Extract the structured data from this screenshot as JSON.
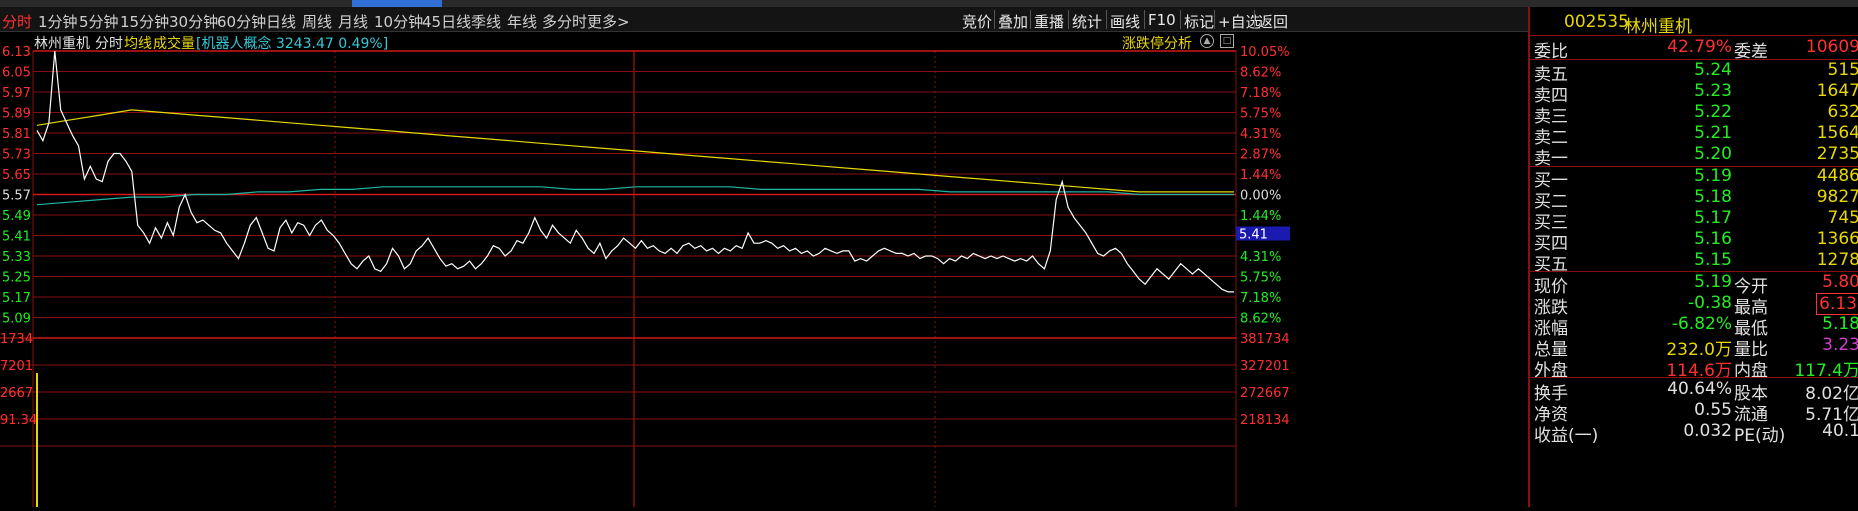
{
  "toolbar": {
    "left_tabs": [
      "分时",
      "1分钟",
      "5分钟",
      "15分钟",
      "30分钟",
      "60分钟",
      "日线",
      "周线",
      "月线",
      "10分钟",
      "45日线",
      "季线",
      "年线",
      "多分时",
      "更多>"
    ],
    "active_tab": "分时",
    "right_buttons": [
      "竞价",
      "叠加",
      "重播",
      "统计",
      "画线",
      "F10",
      "标记",
      "+自选",
      "返回"
    ]
  },
  "legend": {
    "stock_name": "林州重机",
    "mode": "分时",
    "avg_line": "均线",
    "volume": "成交量",
    "sector": "[机器人概念 3243.47 0.49%]",
    "analysis": "涨跌停分析"
  },
  "price_axis": {
    "left": [
      "6.13",
      "6.05",
      "5.97",
      "5.89",
      "5.81",
      "5.73",
      "5.65",
      "5.57",
      "5.49",
      "5.41",
      "5.33",
      "5.25",
      "5.17",
      "5.09"
    ],
    "right": [
      "10.05%",
      "8.62%",
      "7.18%",
      "5.75%",
      "4.31%",
      "2.87%",
      "1.44%",
      "0.00%",
      "1.44%",
      "2.87%",
      "4.31%",
      "5.75%",
      "7.18%",
      "8.62%"
    ],
    "cursor_value": "5.41"
  },
  "volume_axis": {
    "left": [
      "1734",
      "7201",
      "2667",
      "91.34"
    ],
    "right": [
      "381734",
      "327201",
      "272667",
      "218134"
    ]
  },
  "chart_data": {
    "type": "line",
    "series": [
      {
        "values": [
          5.82,
          5.78,
          5.85,
          6.13,
          5.9,
          5.85,
          5.8,
          5.76,
          5.63,
          5.68,
          5.63,
          5.62,
          5.7,
          5.73,
          5.73,
          5.7,
          5.66,
          5.45,
          5.42,
          5.38,
          5.44,
          5.4,
          5.46,
          5.41,
          5.52,
          5.57,
          5.5,
          5.46,
          5.47,
          5.45,
          5.43,
          5.42,
          5.38,
          5.35,
          5.32,
          5.38,
          5.45,
          5.48,
          5.42,
          5.36,
          5.35,
          5.44,
          5.47,
          5.42,
          5.46,
          5.45,
          5.41,
          5.45,
          5.47,
          5.43,
          5.41,
          5.38,
          5.34,
          5.3,
          5.28,
          5.31,
          5.33,
          5.28,
          5.27,
          5.3,
          5.36,
          5.33,
          5.28,
          5.3,
          5.35,
          5.37,
          5.4,
          5.36,
          5.32,
          5.29,
          5.3,
          5.28,
          5.29,
          5.31,
          5.28,
          5.3,
          5.33,
          5.37,
          5.36,
          5.33,
          5.35,
          5.39,
          5.38,
          5.42,
          5.48,
          5.43,
          5.4,
          5.45,
          5.42,
          5.4,
          5.38,
          5.43,
          5.4,
          5.36,
          5.34,
          5.38,
          5.32,
          5.35,
          5.37,
          5.4,
          5.38,
          5.36,
          5.39,
          5.36,
          5.37,
          5.35,
          5.34,
          5.36,
          5.34,
          5.37,
          5.38,
          5.36,
          5.37,
          5.35,
          5.36,
          5.34,
          5.36,
          5.35,
          5.37,
          5.36,
          5.42,
          5.38,
          5.38,
          5.39,
          5.38,
          5.36,
          5.37,
          5.35,
          5.36,
          5.34,
          5.35,
          5.33,
          5.34,
          5.36,
          5.35,
          5.34,
          5.35,
          5.35,
          5.31,
          5.32,
          5.31,
          5.33,
          5.35,
          5.36,
          5.35,
          5.34,
          5.34,
          5.33,
          5.34,
          5.32,
          5.33,
          5.33,
          5.32,
          5.3,
          5.32,
          5.31,
          5.33,
          5.32,
          5.34,
          5.33,
          5.32,
          5.33,
          5.32,
          5.33,
          5.32,
          5.31,
          5.32,
          5.31,
          5.33,
          5.3,
          5.28,
          5.35,
          5.55,
          5.62,
          5.52,
          5.48,
          5.45,
          5.42,
          5.38,
          5.34,
          5.33,
          5.35,
          5.36,
          5.34,
          5.3,
          5.27,
          5.24,
          5.22,
          5.25,
          5.28,
          5.26,
          5.24,
          5.27,
          5.3,
          5.28,
          5.26,
          5.28,
          5.26,
          5.24,
          5.22,
          5.2,
          5.19,
          5.19
        ]
      },
      {
        "values": [
          5.84,
          5.86,
          5.88,
          5.9,
          5.89,
          5.88,
          5.87,
          5.86,
          5.85,
          5.84,
          5.83,
          5.82,
          5.81,
          5.8,
          5.79,
          5.78,
          5.77,
          5.76,
          5.75,
          5.74,
          5.73,
          5.72,
          5.71,
          5.7,
          5.69,
          5.68,
          5.67,
          5.66,
          5.65,
          5.64,
          5.63,
          5.62,
          5.61,
          5.6,
          5.59,
          5.58,
          5.58,
          5.58,
          5.58
        ]
      },
      {
        "values": [
          5.53,
          5.54,
          5.55,
          5.56,
          5.56,
          5.57,
          5.57,
          5.58,
          5.58,
          5.59,
          5.59,
          5.6,
          5.6,
          5.6,
          5.6,
          5.6,
          5.6,
          5.59,
          5.59,
          5.6,
          5.6,
          5.6,
          5.6,
          5.59,
          5.59,
          5.59,
          5.59,
          5.59,
          5.59,
          5.58,
          5.58,
          5.58,
          5.58,
          5.58,
          5.58,
          5.57,
          5.57,
          5.57,
          5.57
        ]
      }
    ]
  },
  "quote": {
    "code": "002535",
    "name": "林州重机",
    "weibi_label": "委比",
    "weibi": "42.79%",
    "weicha_label": "委差",
    "weicha": "10609",
    "sells": [
      {
        "label": "卖五",
        "price": "5.24",
        "vol": "515"
      },
      {
        "label": "卖四",
        "price": "5.23",
        "vol": "1647"
      },
      {
        "label": "卖三",
        "price": "5.22",
        "vol": "632"
      },
      {
        "label": "卖二",
        "price": "5.21",
        "vol": "1564"
      },
      {
        "label": "卖一",
        "price": "5.20",
        "vol": "2735"
      }
    ],
    "buys": [
      {
        "label": "买一",
        "price": "5.19",
        "vol": "4486"
      },
      {
        "label": "买二",
        "price": "5.18",
        "vol": "9827"
      },
      {
        "label": "买三",
        "price": "5.17",
        "vol": "745"
      },
      {
        "label": "买四",
        "price": "5.16",
        "vol": "1366"
      },
      {
        "label": "买五",
        "price": "5.15",
        "vol": "1278"
      }
    ],
    "stats": [
      {
        "l1": "现价",
        "v1": "5.19",
        "l2": "今开",
        "v2": "5.80"
      },
      {
        "l1": "涨跌",
        "v1": "-0.38",
        "l2": "最高",
        "v2": "6.13"
      },
      {
        "l1": "涨幅",
        "v1": "-6.82%",
        "l2": "最低",
        "v2": "5.18"
      },
      {
        "l1": "总量",
        "v1": "232.0万",
        "l2": "量比",
        "v2": "3.23"
      },
      {
        "l1": "外盘",
        "v1": "114.6万",
        "l2": "内盘",
        "v2": "117.4万"
      }
    ],
    "fund": [
      {
        "l1": "换手",
        "v1": "40.64%",
        "l2": "股本",
        "v2": "8.02亿"
      },
      {
        "l1": "净资",
        "v1": "0.55",
        "l2": "流通",
        "v2": "5.71亿"
      },
      {
        "l1": "收益(一)",
        "v1": "0.032",
        "l2": "PE(动)",
        "v2": "40.1"
      }
    ]
  },
  "colors": {
    "up": "#ff3030",
    "down": "#22ee22",
    "grid": "#8a1010",
    "price_line": "#ffffff",
    "avg_line": "#e8d800",
    "sector_line": "#1fb5a5",
    "label_cyan": "#35c8d8"
  }
}
